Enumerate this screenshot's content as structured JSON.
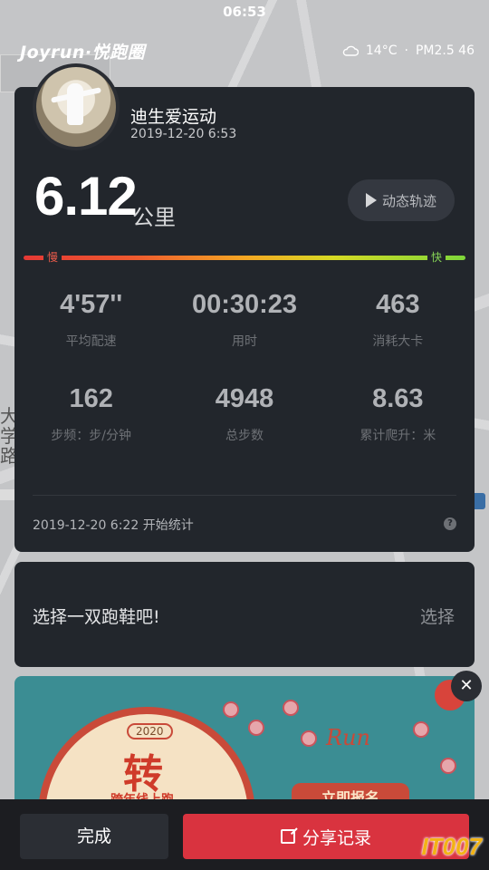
{
  "status_bar": {
    "time": "06:53"
  },
  "header": {
    "logo": "Joyrun·悦跑圈",
    "weather_icon": "cloud-icon",
    "temperature": "14°C",
    "air_quality": "PM2.5 46"
  },
  "map": {
    "labels": [
      "大学路",
      "学",
      "路"
    ]
  },
  "run_card": {
    "user_name": "迪生爱运动",
    "run_datetime": "2019-12-20 6:53",
    "distance": "6.12",
    "distance_unit": "公里",
    "replay_label": "动态轨迹",
    "pace_slow_label": "慢",
    "pace_fast_label": "快",
    "stats": [
      {
        "value": "4'57''",
        "label": "平均配速"
      },
      {
        "value": "00:30:23",
        "label": "用时"
      },
      {
        "value": "463",
        "label": "消耗大卡"
      },
      {
        "value": "162",
        "label": "步频：步/分钟"
      },
      {
        "value": "4948",
        "label": "总步数"
      },
      {
        "value": "8.63",
        "label": "累计爬升：米"
      }
    ],
    "start_text": "2019-12-20 6:22 开始统计",
    "help_glyph": "?"
  },
  "shoe_card": {
    "prompt": "选择一双跑鞋吧!",
    "select_label": "选择"
  },
  "banner": {
    "badge": "2020",
    "headline_char": "转",
    "subline": "跨年线上跑",
    "run_text": "Run",
    "cta_label": "立即报名"
  },
  "close_ad_glyph": "✕",
  "bottom_bar": {
    "done_label": "完成",
    "share_label": "分享记录"
  },
  "watermark": "IT007",
  "colors": {
    "card_bg": "#22262c",
    "accent_red": "#d9333f",
    "pace_slow": "#e65a4a",
    "pace_fast": "#86d456"
  }
}
